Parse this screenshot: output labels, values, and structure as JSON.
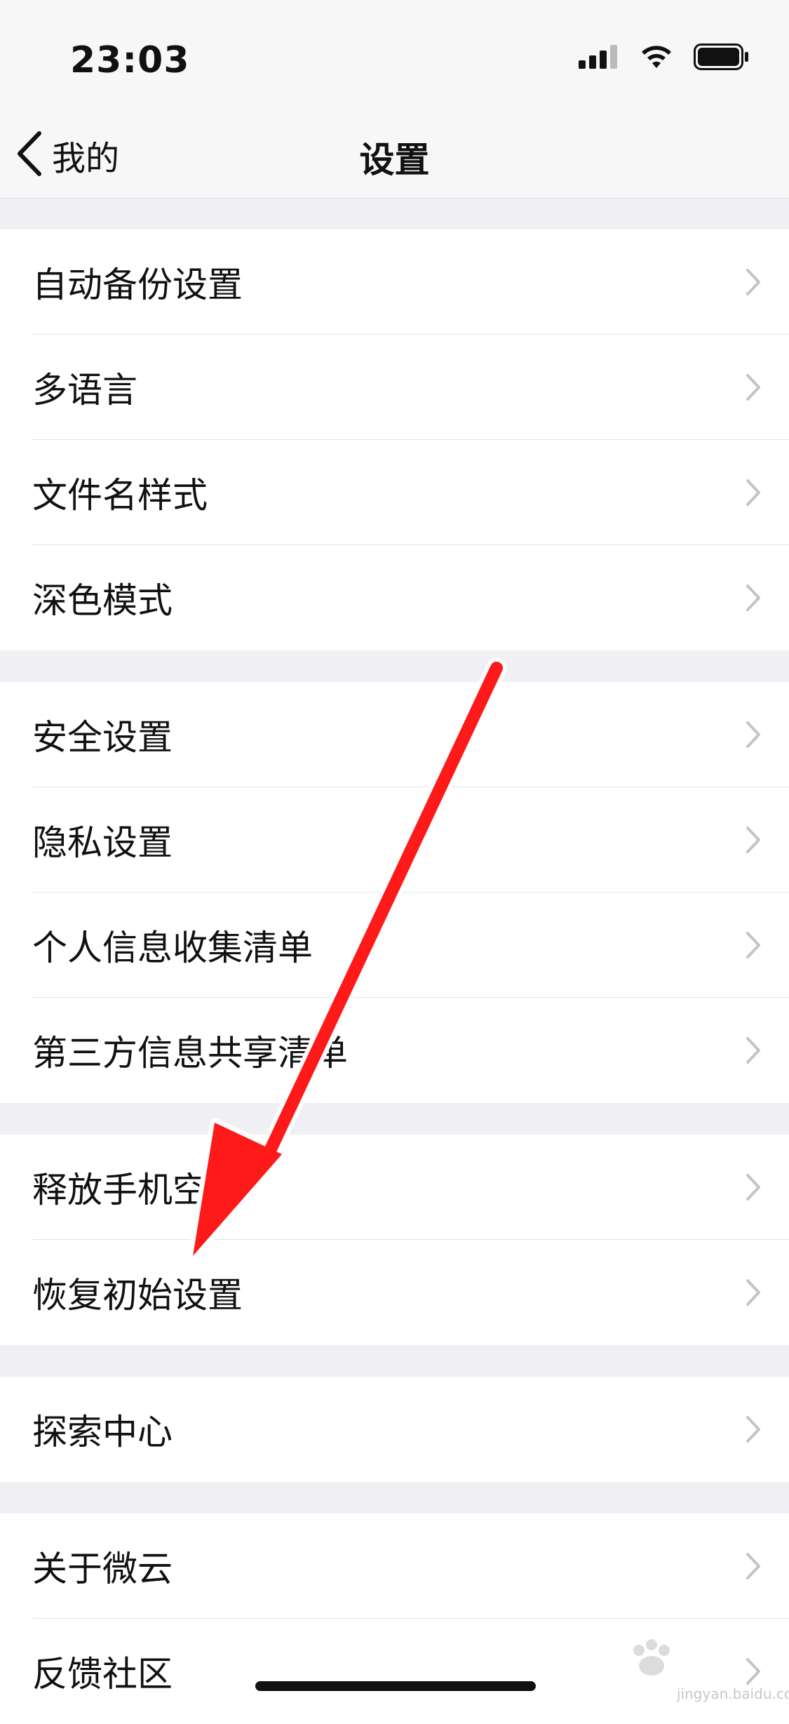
{
  "status_bar": {
    "time": "23:03",
    "icons": [
      "cellular-signal-icon",
      "wifi-icon",
      "battery-icon"
    ]
  },
  "nav": {
    "back_label": "我的",
    "title": "设置"
  },
  "groups": [
    {
      "items": [
        {
          "label": "自动备份设置"
        },
        {
          "label": "多语言"
        },
        {
          "label": "文件名样式"
        },
        {
          "label": "深色模式"
        }
      ]
    },
    {
      "items": [
        {
          "label": "安全设置"
        },
        {
          "label": "隐私设置"
        },
        {
          "label": "个人信息收集清单"
        },
        {
          "label": "第三方信息共享清单"
        }
      ]
    },
    {
      "items": [
        {
          "label": "释放手机空间"
        },
        {
          "label": "恢复初始设置"
        }
      ]
    },
    {
      "items": [
        {
          "label": "探索中心"
        }
      ]
    },
    {
      "items": [
        {
          "label": "关于微云"
        },
        {
          "label": "反馈社区"
        }
      ]
    }
  ],
  "annotation": {
    "arrow_color": "#ff1a1a"
  },
  "watermark": {
    "text": "jingyan.baidu.com"
  }
}
